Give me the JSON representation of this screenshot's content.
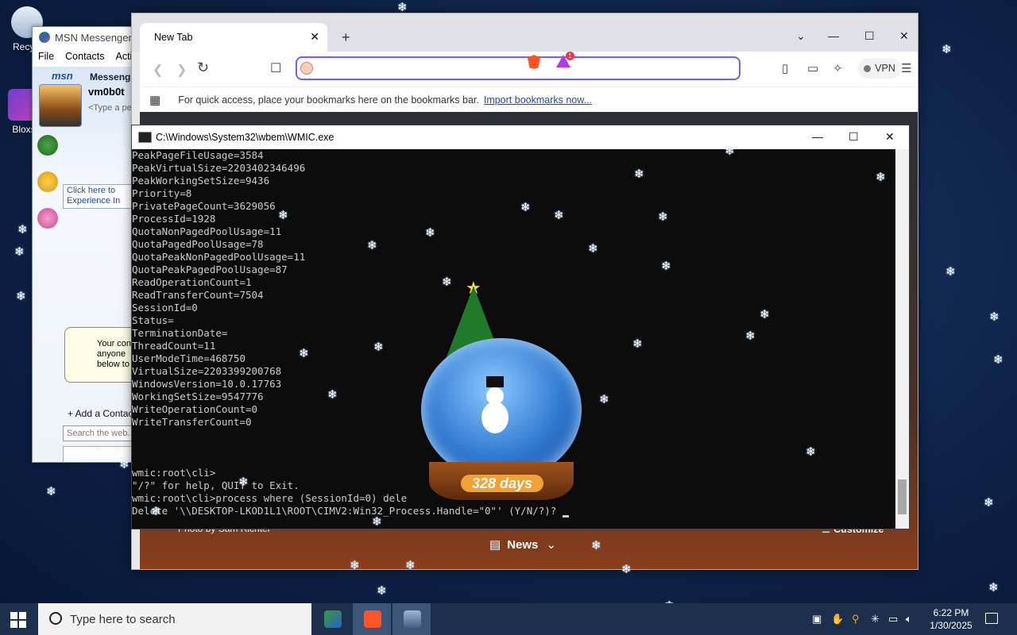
{
  "desktop": {
    "icons": [
      {
        "label": "Recycl"
      },
      {
        "label": "Bloxs"
      }
    ]
  },
  "msn": {
    "title": "MSN Messenger",
    "menu": [
      "File",
      "Contacts",
      "Actio"
    ],
    "brand": "msn",
    "brand_word": "Messeng",
    "username": "vm0b0t",
    "personal_message": "<Type a pe",
    "info_bar": "Click here to Experience In",
    "bubble_text": "Your con anyone below to",
    "add_contact": "+ Add a Contac",
    "search_placeholder": "Search the web...",
    "ad_text": "msn"
  },
  "browser": {
    "tab_title": "New Tab",
    "new_tab_glyph": "+",
    "window_controls": [
      "⌄",
      "—",
      "☐",
      "✕"
    ],
    "omnibox_value": "",
    "rewards_badge": "1",
    "vpn_label": "VPN",
    "bookmarks_hint": "For quick access, place your bookmarks here on the bookmarks bar.",
    "import_link": "Import bookmarks now...",
    "photo_credit": "Photo by Sam Richter",
    "news_label": "News",
    "customize_label": "Customize",
    "accent_color": "#7a5af8"
  },
  "console": {
    "title": "C:\\Windows\\System32\\wbem\\WMIC.exe",
    "lines": [
      "PeakPageFileUsage=3584",
      "PeakVirtualSize=2203402346496",
      "PeakWorkingSetSize=9436",
      "Priority=8",
      "PrivatePageCount=3629056",
      "ProcessId=1928",
      "QuotaNonPagedPoolUsage=11",
      "QuotaPagedPoolUsage=78",
      "QuotaPeakNonPagedPoolUsage=11",
      "QuotaPeakPagedPoolUsage=87",
      "ReadOperationCount=1",
      "ReadTransferCount=7504",
      "SessionId=0",
      "Status=",
      "TerminationDate=",
      "ThreadCount=11",
      "UserModeTime=468750",
      "VirtualSize=2203399200768",
      "WindowsVersion=10.0.17763",
      "WorkingSetSize=9547776",
      "WriteOperationCount=0",
      "WriteTransferCount=0",
      "",
      "",
      "",
      "wmic:root\\cli>",
      "\"/?\" for help, QUIT to Exit.",
      "wmic:root\\cli>process where (SessionId=0) dele",
      "Delete '\\\\DESKTOP-LKOD1L1\\ROOT\\CIMV2:Win32_Process.Handle=\"0\"' (Y/N/?)?"
    ]
  },
  "snowglobe": {
    "days_label": "328 days"
  },
  "taskbar": {
    "search_placeholder": "Type here to search",
    "time": "6:22 PM",
    "date": "1/30/2025"
  }
}
